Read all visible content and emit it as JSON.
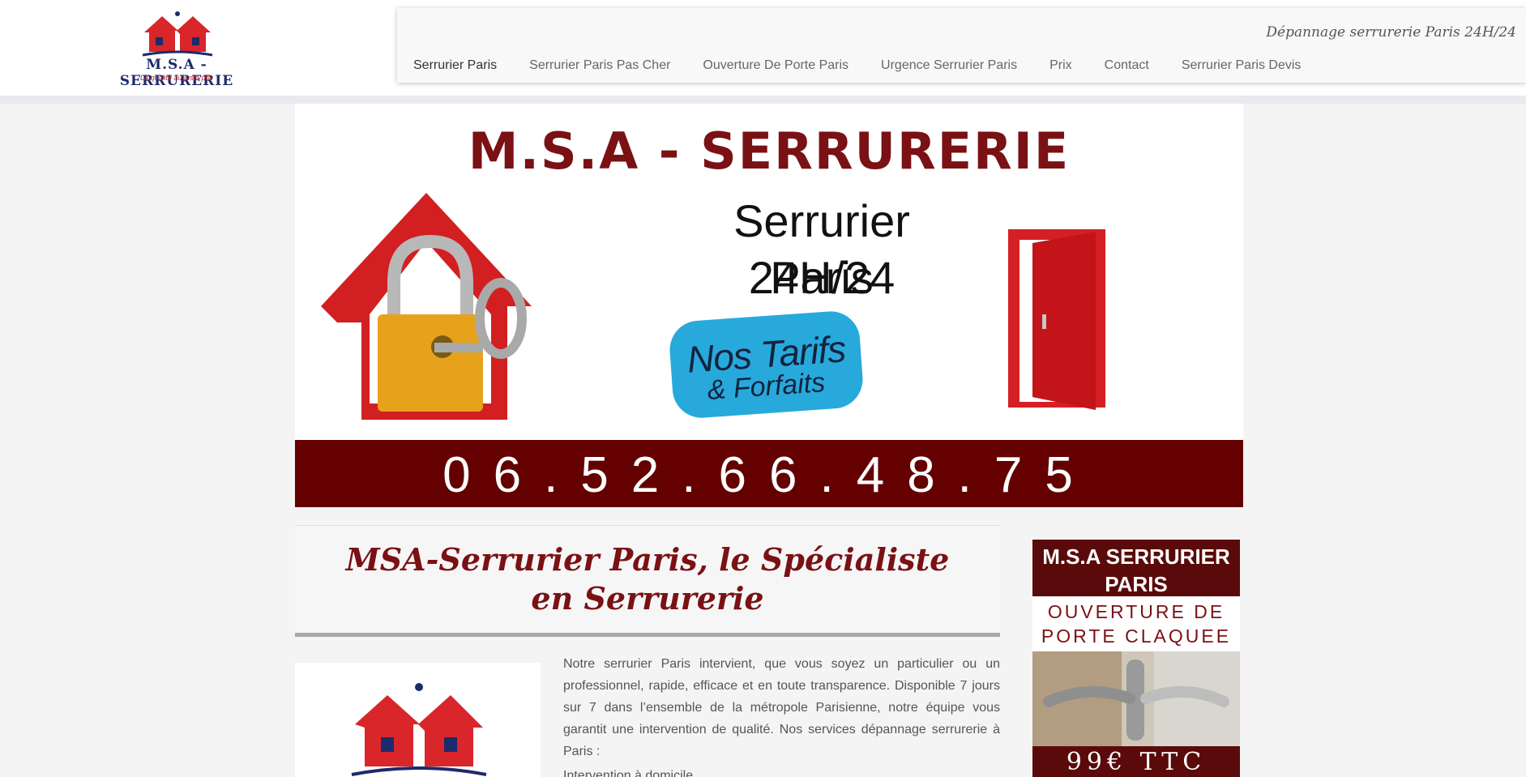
{
  "site": {
    "logo_title": "M.S.A - SERRURERIE",
    "logo_subtitle": "La qualité au juste prix",
    "tagline": "Dépannage serrurerie Paris 24H/24"
  },
  "nav": {
    "items": [
      {
        "label": "Serrurier Paris",
        "active": true
      },
      {
        "label": "Serrurier Paris Pas Cher",
        "active": false
      },
      {
        "label": "Ouverture De Porte Paris",
        "active": false
      },
      {
        "label": "Urgence Serrurier Paris",
        "active": false
      },
      {
        "label": "Prix",
        "active": false
      },
      {
        "label": "Contact",
        "active": false
      },
      {
        "label": "Serrurier Paris Devis",
        "active": false
      }
    ]
  },
  "banner": {
    "brand": "M.S.A - SERRURERIE",
    "headline_line1": "Serrurier Paris",
    "headline_line2": "24H/24",
    "badge_line1": "Nos Tarifs",
    "badge_line2": "& Forfaits",
    "phone": "06.52.66.48.75",
    "colors": {
      "brand": "#7a1114",
      "phone_bar": "#640000",
      "badge": "#27a9dc"
    }
  },
  "content": {
    "title": "MSA-Serrurier Paris, le Spécialiste en Serrurerie",
    "paragraph": "Notre serrurier Paris intervient, que vous soyez un particulier ou un professionnel, rapide, efficace et en toute transparence. Disponible 7 jours sur 7 dans l’ensemble de la métropole Parisienne, notre équipe vous garantit une intervention de qualité. Nos services dépannage serrurerie à Paris :",
    "list_item_partial": "Intervention à domicile"
  },
  "sidebar_ad": {
    "title": "M.S.A SERRURIER PARIS",
    "subtitle_line1": "OUVERTURE DE",
    "subtitle_line2": "PORTE CLAQUEE",
    "price": "99€ TTC"
  }
}
